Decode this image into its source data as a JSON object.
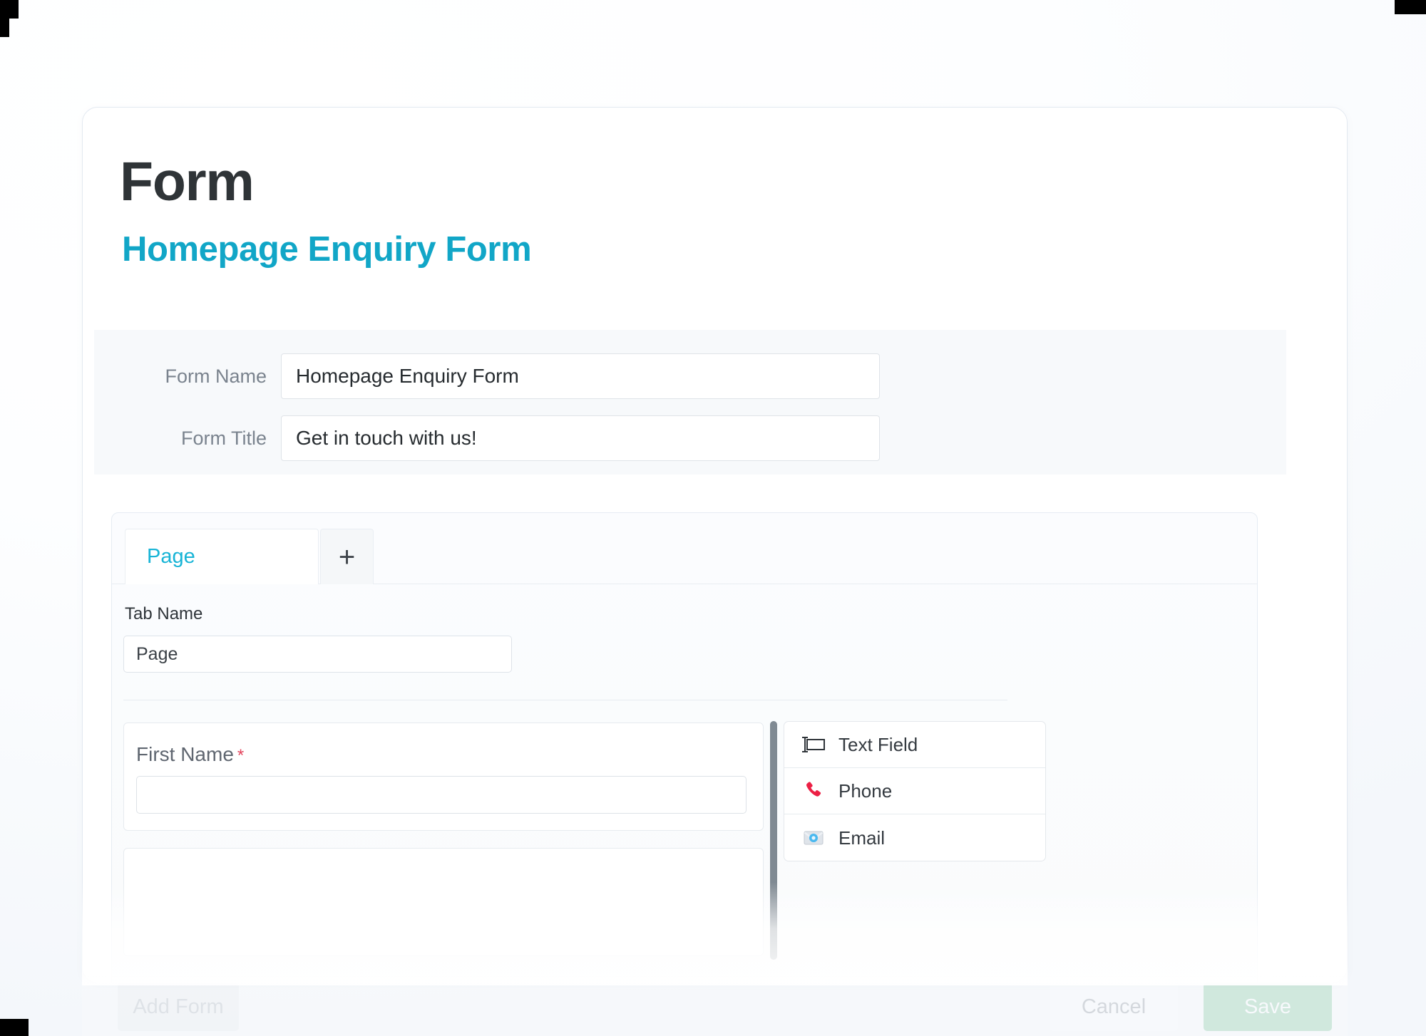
{
  "header": {
    "title": "Form",
    "subtitle": "Homepage Enquiry Form"
  },
  "meta": {
    "form_name_label": "Form Name",
    "form_name_value": "Homepage Enquiry Form",
    "form_title_label": "Form Title",
    "form_title_value": "Get in touch with us!"
  },
  "builder": {
    "tabs": [
      {
        "label": "Page",
        "active": true
      },
      {
        "label": "+",
        "active": false,
        "icon": "plus-icon"
      }
    ],
    "tab_name_label": "Tab Name",
    "tab_name_value": "Page",
    "fields": [
      {
        "label": "First Name",
        "required": true,
        "required_mark": "*",
        "value": ""
      }
    ],
    "palette_title": "",
    "palette": [
      {
        "label": "Text Field",
        "icon": "text-field-icon"
      },
      {
        "label": "Phone",
        "icon": "phone-icon"
      },
      {
        "label": "Email",
        "icon": "email-icon"
      }
    ]
  },
  "footer": {
    "add_form_label": "Add Form",
    "cancel_label": "Cancel",
    "save_label": "Save"
  },
  "colors": {
    "accent": "#11a6c7",
    "tab_active_text": "#17b4d6",
    "required": "#e3435b",
    "save_button": "#7fc79a",
    "heading": "#2f3437",
    "label": "#7a838e"
  }
}
